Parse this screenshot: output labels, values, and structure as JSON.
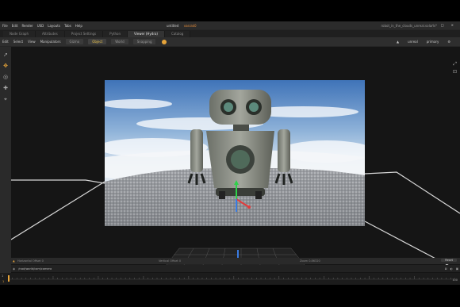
{
  "menubar": {
    "items": [
      "File",
      "Edit",
      "Render",
      "USD",
      "Layouts",
      "Tabs",
      "Help"
    ],
    "center_prefix": "untitled",
    "center_name": "vasrak0",
    "right_text": "robot_in_the_clouds_unreal.solaris*"
  },
  "window_controls": [
    "–",
    "□",
    "×"
  ],
  "tabs": [
    {
      "label": "Node Graph",
      "active": false
    },
    {
      "label": "Attributes",
      "active": false
    },
    {
      "label": "Project Settings",
      "active": false
    },
    {
      "label": "Python",
      "active": false
    },
    {
      "label": "Viewer (Hydra)",
      "active": true
    },
    {
      "label": "Catalog",
      "active": false
    }
  ],
  "toolbar": {
    "menus": [
      "Edit",
      "Select",
      "View",
      "Manipulators"
    ],
    "transform": "Gizmo",
    "space_object": "Object",
    "space_world": "World",
    "snapping": "Snapping",
    "renderer": "unreal",
    "shading": "primary"
  },
  "status": {
    "horizontal_offset": "Horizontal Offset  0",
    "vertical_offset": "Vertical Offset  0",
    "zoom": "Zoom  0.86320",
    "reset": "Reset"
  },
  "path": {
    "value": "/root/world/cam/camera"
  },
  "timeline": {
    "start": "1",
    "end": "100",
    "ticks": [
      "1",
      "10",
      "20",
      "30",
      "40",
      "50",
      "60",
      "70",
      "80",
      "90",
      "100"
    ],
    "current": "1"
  },
  "colors": {
    "accent": "#e6a43a",
    "panel": "#262626",
    "viewport": "#151515"
  }
}
